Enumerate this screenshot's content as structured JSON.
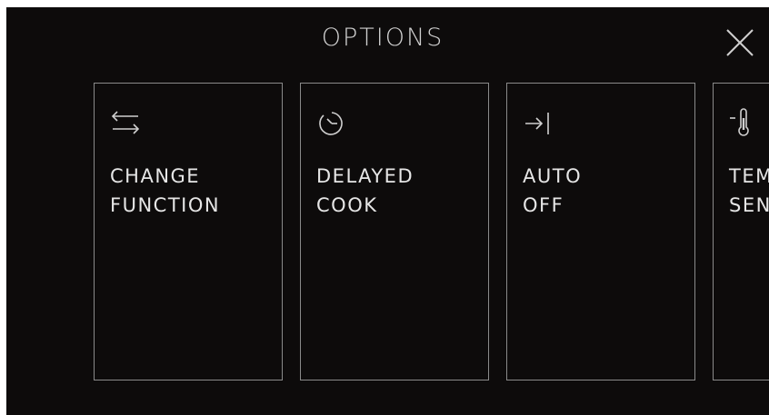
{
  "header": {
    "title": "OPTIONS"
  },
  "icons": {
    "close": "close-icon",
    "change_function": "swap-arrows-icon",
    "delayed_cook": "clock-icon",
    "auto_off": "arrow-to-bar-icon",
    "temp_sensor": "thermometer-icon"
  },
  "options": [
    {
      "line1": "CHANGE",
      "line2": "FUNCTION"
    },
    {
      "line1": "DELAYED",
      "line2": "COOK"
    },
    {
      "line1": "AUTO",
      "line2": "OFF"
    },
    {
      "line1": "TEMP",
      "line2": "SENSOR"
    }
  ],
  "colors": {
    "background": "#0d0b0b",
    "card_border": "#8a8a8a",
    "text": "#e6e6e6"
  }
}
